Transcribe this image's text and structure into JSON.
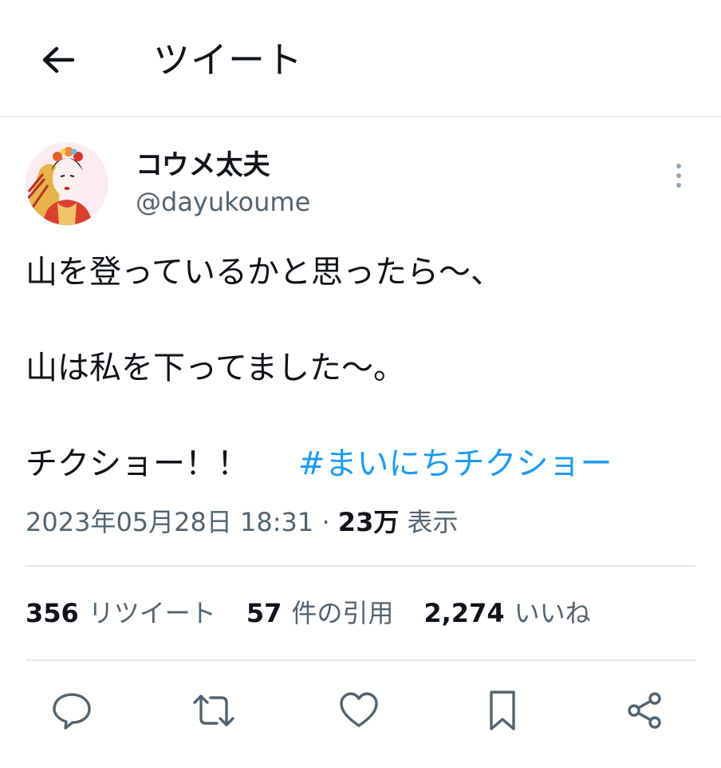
{
  "header": {
    "title": "ツイート"
  },
  "author": {
    "name": "コウメ太夫",
    "handle": "@dayukoume"
  },
  "tweet": {
    "lines": [
      "山を登っているかと思ったら〜、",
      "山は私を下ってました〜。",
      "チクショー！！"
    ],
    "hashtag": "#まいにちチクショー"
  },
  "meta": {
    "timestamp": "2023年05月28日 18:31",
    "separator": "·",
    "views": "23万",
    "views_label": "表示"
  },
  "stats": {
    "retweets": "356",
    "retweets_label": "リツイート",
    "quotes": "57",
    "quotes_label": "件の引用",
    "likes": "2,274",
    "likes_label": "いいね"
  },
  "icons": {
    "back": "arrow-left-icon",
    "more": "more-vertical-icon",
    "reply": "reply-icon",
    "retweet": "retweet-icon",
    "like": "heart-icon",
    "bookmark": "bookmark-icon",
    "share": "share-icon"
  },
  "colors": {
    "link": "#1d9bf0",
    "secondary_text": "#536471",
    "primary_text": "#0f1419"
  }
}
